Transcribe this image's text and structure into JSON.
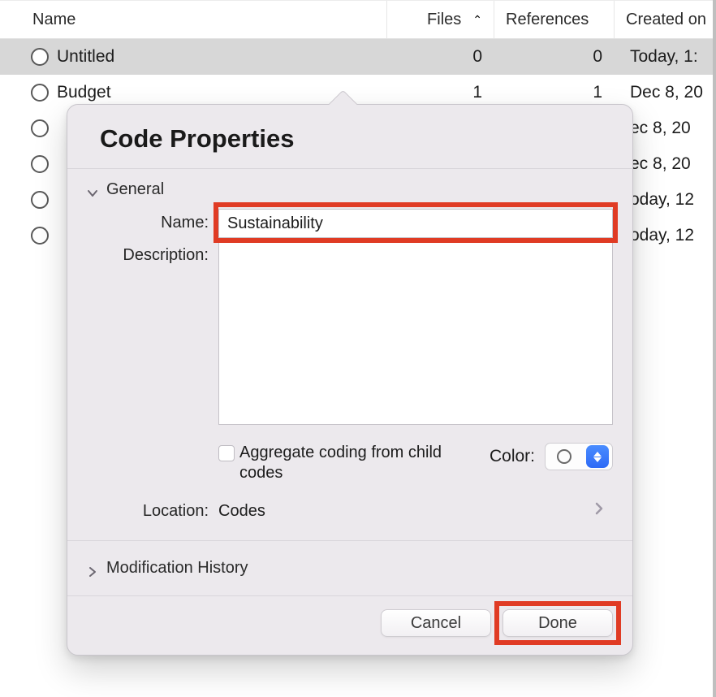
{
  "table": {
    "headers": {
      "name": "Name",
      "files": "Files",
      "references": "References",
      "created_on": "Created on"
    },
    "rows": [
      {
        "name": "Untitled",
        "files": "0",
        "references": "0",
        "created_on": "Today, 1:",
        "selected": true
      },
      {
        "name": "Budget",
        "files": "1",
        "references": "1",
        "created_on": "Dec 8, 20",
        "selected": false
      },
      {
        "name": "",
        "files": "",
        "references": "",
        "created_on": "ec 8, 20",
        "selected": false
      },
      {
        "name": "",
        "files": "",
        "references": "",
        "created_on": "ec 8, 20",
        "selected": false
      },
      {
        "name": "",
        "files": "",
        "references": "",
        "created_on": "oday, 12",
        "selected": false
      },
      {
        "name": "",
        "files": "",
        "references": "",
        "created_on": "oday, 12",
        "selected": false
      }
    ]
  },
  "dialog": {
    "title": "Code Properties",
    "sections": {
      "general": {
        "label": "General",
        "fields": {
          "name_label": "Name:",
          "name_value": "Sustainability",
          "description_label": "Description:",
          "description_value": "",
          "aggregate_label": "Aggregate coding from child codes",
          "color_label": "Color:",
          "location_label": "Location:",
          "location_value": "Codes"
        }
      },
      "history": {
        "label": "Modification History"
      }
    },
    "buttons": {
      "cancel": "Cancel",
      "done": "Done"
    }
  }
}
